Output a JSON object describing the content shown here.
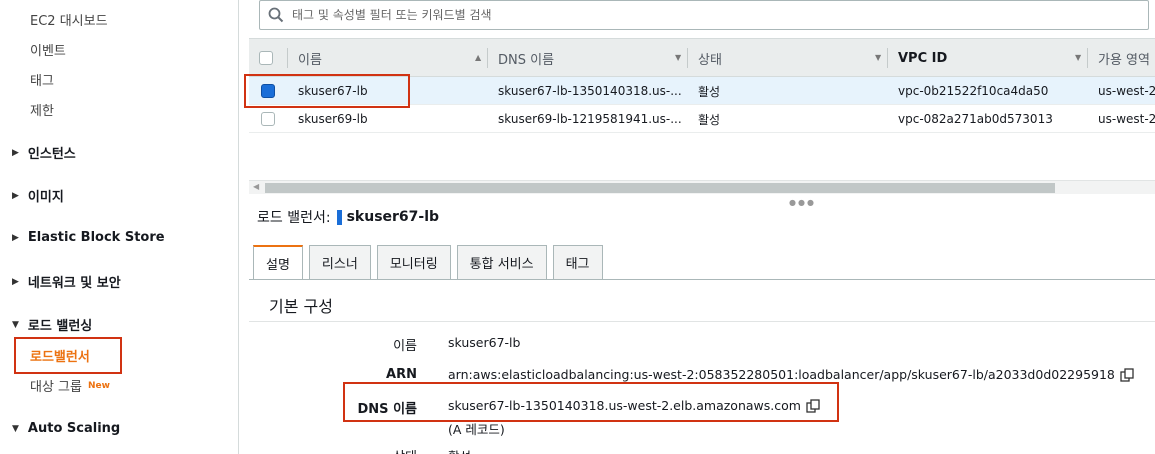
{
  "sidebar": {
    "top_items": [
      "EC2 대시보드",
      "이벤트",
      "태그",
      "제한"
    ],
    "groups": {
      "instances": "인스턴스",
      "images": "이미지",
      "ebs": "Elastic Block Store",
      "network": "네트워크 및 보안",
      "load_balancing": "로드 밸런싱",
      "auto_scaling": "Auto Scaling"
    },
    "lb_items": {
      "load_balancers": "로드밸런서",
      "target_groups": "대상 그룹",
      "new_badge": "New"
    }
  },
  "search": {
    "placeholder": "태그 및 속성별 필터 또는 키워드별 검색"
  },
  "table": {
    "columns": [
      "이름",
      "DNS 이름",
      "상태",
      "VPC ID",
      "가용 영역"
    ],
    "rows": [
      {
        "name": "skuser67-lb",
        "dns": "skuser67-lb-1350140318.us-...",
        "state": "활성",
        "vpc": "vpc-0b21522f10ca4da50",
        "az": "us-west-2",
        "selected": true
      },
      {
        "name": "skuser69-lb",
        "dns": "skuser69-lb-1219581941.us-...",
        "state": "활성",
        "vpc": "vpc-082a271ab0d573013",
        "az": "us-west-2",
        "selected": false
      }
    ]
  },
  "detail": {
    "prefix": "로드 밸런서:",
    "name": "skuser67-lb",
    "tabs": [
      "설명",
      "리스너",
      "모니터링",
      "통합 서비스",
      "태그"
    ],
    "active_tab": "설명",
    "section_title": "기본 구성",
    "fields": {
      "name_label": "이름",
      "name_value": "skuser67-lb",
      "arn_label": "ARN",
      "arn_value": "arn:aws:elasticloadbalancing:us-west-2:058352280501:loadbalancer/app/skuser67-lb/a2033d0d02295918",
      "dns_label": "DNS 이름",
      "dns_value": "skuser67-lb-1350140318.us-west-2.elb.amazonaws.com",
      "dns_record": "(A 레코드)",
      "state_label": "상태",
      "state_value": "활성"
    }
  },
  "colors": {
    "accent": "#ec7211",
    "highlight": "#d13212",
    "selected_row": "#e7f3fc",
    "checkbox": "#1a6ed8"
  }
}
